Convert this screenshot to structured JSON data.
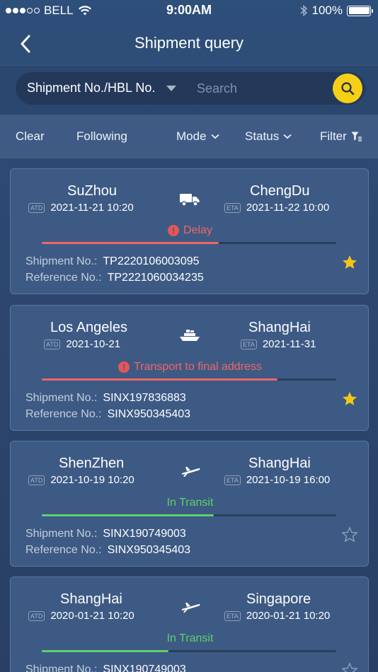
{
  "status_bar": {
    "carrier": "BELL",
    "time": "9:00AM",
    "battery": "100%"
  },
  "nav": {
    "title": "Shipment query"
  },
  "search": {
    "type_label": "Shipment No./HBL No.",
    "placeholder": "Search"
  },
  "filters": {
    "clear": "Clear",
    "following": "Following",
    "mode": "Mode",
    "status": "Status",
    "filter": "Filter"
  },
  "labels": {
    "atd": "ATD",
    "eta": "ETA",
    "shipment_no": "Shipment No.:",
    "reference_no": "Reference No.:"
  },
  "colors": {
    "delay": "#f06666",
    "in_transit": "#5fcf6b",
    "star_filled": "#f5c518",
    "search_button": "#f5d016"
  },
  "shipments": [
    {
      "from": "SuZhou",
      "to": "ChengDu",
      "atd": "2021-11-21 10:20",
      "eta": "2021-11-22 10:00",
      "mode_icon": "truck-icon",
      "status": "Delay",
      "status_color": "red",
      "progress": 0.6,
      "shipment_no": "TP2220106003095",
      "reference_no": "TP2221060034235",
      "followed": true
    },
    {
      "from": "Los Angeles",
      "to": "ShangHai",
      "atd": "2021-10-21",
      "eta": "2021-11-31",
      "mode_icon": "ship-icon",
      "status": "Transport to final address",
      "status_color": "red",
      "progress": 0.8,
      "shipment_no": "SINX197836883",
      "reference_no": "SINX950345403",
      "followed": true
    },
    {
      "from": "ShenZhen",
      "to": "ShangHai",
      "atd": "2021-10-19 10:20",
      "eta": "2021-10-19 16:00",
      "mode_icon": "plane-icon",
      "status": "In Transit",
      "status_color": "green",
      "progress": 0.585,
      "shipment_no": "SINX190749003",
      "reference_no": "SINX950345403",
      "followed": false
    },
    {
      "from": "ShangHai",
      "to": "Singapore",
      "atd": "2020-01-21 10:20",
      "eta": "2020-01-21 10:20",
      "mode_icon": "plane-icon",
      "status": "In Transit",
      "status_color": "green",
      "progress": 0.43,
      "shipment_no": "SINX190749003",
      "reference_no": "",
      "followed": false
    }
  ]
}
